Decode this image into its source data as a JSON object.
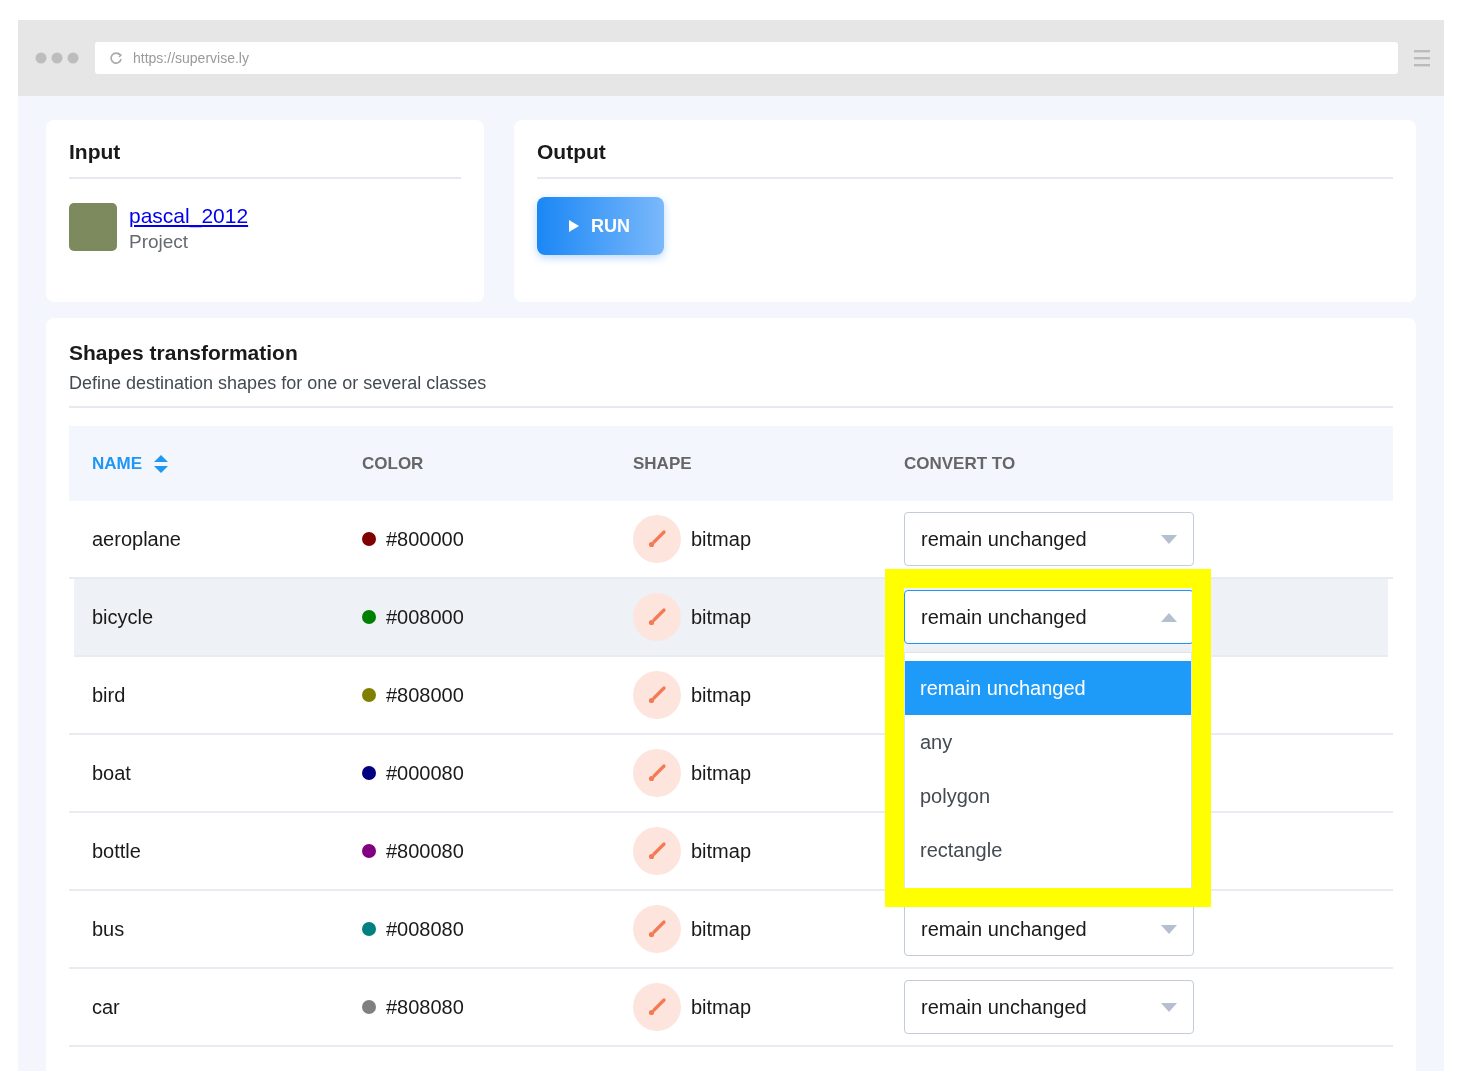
{
  "browser": {
    "url": "https://supervise.ly"
  },
  "input": {
    "title": "Input",
    "project_name": "pascal_2012",
    "project_type": "Project"
  },
  "output": {
    "title": "Output",
    "run_label": "RUN"
  },
  "shapes": {
    "title": "Shapes transformation",
    "subtitle": "Define destination shapes for one or several classes",
    "columns": [
      {
        "label": "NAME",
        "sorted": true
      },
      {
        "label": "COLOR",
        "sorted": false
      },
      {
        "label": "SHAPE",
        "sorted": false
      },
      {
        "label": "CONVERT TO",
        "sorted": false
      }
    ],
    "rows": [
      {
        "name": "aeroplane",
        "color": "#800000",
        "color_label": "#800000",
        "shape": "bitmap",
        "convert": "remain unchanged",
        "open": false,
        "hovered": false
      },
      {
        "name": "bicycle",
        "color": "#008000",
        "color_label": "#008000",
        "shape": "bitmap",
        "convert": "remain unchanged",
        "open": true,
        "hovered": true
      },
      {
        "name": "bird",
        "color": "#808000",
        "color_label": "#808000",
        "shape": "bitmap",
        "open": false,
        "hovered": false
      },
      {
        "name": "boat",
        "color": "#000080",
        "color_label": "#000080",
        "shape": "bitmap",
        "open": false,
        "hovered": false
      },
      {
        "name": "bottle",
        "color": "#800080",
        "color_label": "#800080",
        "shape": "bitmap",
        "open": false,
        "hovered": false
      },
      {
        "name": "bus",
        "color": "#008080",
        "color_label": "#008080",
        "shape": "bitmap",
        "convert": "remain unchanged",
        "open": false,
        "hovered": false
      },
      {
        "name": "car",
        "color": "#808080",
        "color_label": "#808080",
        "shape": "bitmap",
        "convert": "remain unchanged",
        "open": false,
        "hovered": false
      }
    ],
    "options": [
      {
        "label": "remain unchanged",
        "selected": true
      },
      {
        "label": "any",
        "selected": false
      },
      {
        "label": "polygon",
        "selected": false
      },
      {
        "label": "rectangle",
        "selected": false
      }
    ]
  }
}
